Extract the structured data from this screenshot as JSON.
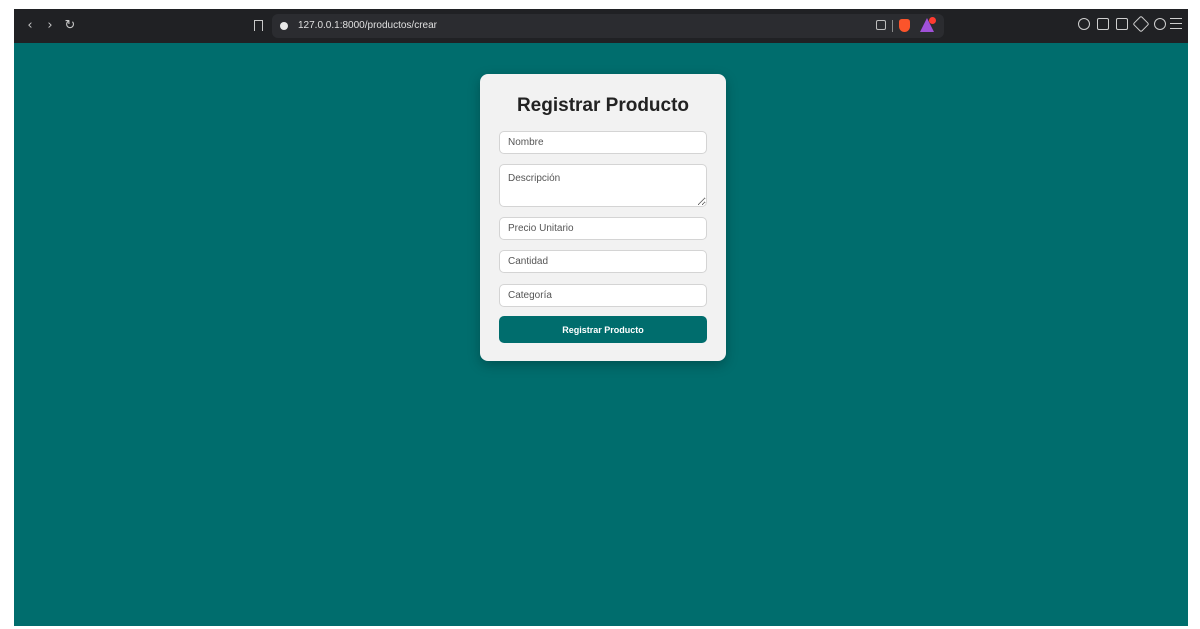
{
  "browser": {
    "url": "127.0.0.1:8000/productos/crear",
    "nav": {
      "back": "‹",
      "forward": "›",
      "reload": "↻"
    },
    "icons": [
      "bookmark-icon",
      "site-info-icon",
      "share-icon",
      "brave-shields-icon",
      "brave-rewards-icon",
      "extensions-icon",
      "sidebar-icon",
      "wallet-icon",
      "leo-icon",
      "vpn-icon",
      "menu-icon"
    ]
  },
  "form": {
    "title": "Registrar Producto",
    "fields": {
      "nombre": {
        "placeholder": "Nombre",
        "value": ""
      },
      "descripcion": {
        "placeholder": "Descripción",
        "value": ""
      },
      "precio_unitario": {
        "placeholder": "Precio Unitario",
        "value": ""
      },
      "cantidad": {
        "placeholder": "Cantidad",
        "value": ""
      },
      "categoria": {
        "placeholder": "Categoría",
        "value": ""
      }
    },
    "submit_label": "Registrar Producto"
  },
  "colors": {
    "page_background": "#006d6d",
    "card_background": "#f2f2f2",
    "button_background": "#006d6d",
    "button_text": "#ffffff"
  }
}
